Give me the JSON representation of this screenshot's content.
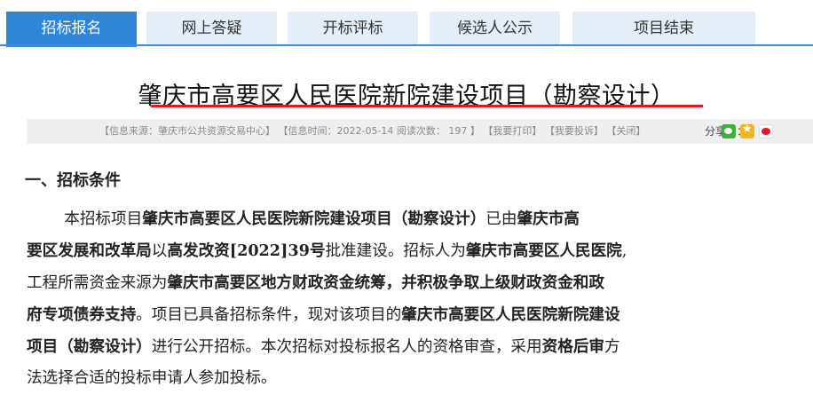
{
  "tabs": [
    {
      "label": "招标报名",
      "active": true
    },
    {
      "label": "网上答疑",
      "active": false
    },
    {
      "label": "开标评标",
      "active": false
    },
    {
      "label": "候选人公示",
      "active": false
    },
    {
      "label": "项目结束",
      "active": false
    }
  ],
  "title": "肇庆市高要区人民医院新院建设项目（勘察设计）",
  "meta": {
    "source": "【信息来源：肇庆市公共资源交易中心】",
    "time": "【信息时间：2022-05-14 阅读次数： 197 】",
    "print": "【我要打印】",
    "complain": "【我要投诉】",
    "close": "【关闭】",
    "share_label": "分享到："
  },
  "section": {
    "heading": "一、招标条件",
    "lines": [
      [
        {
          "t": "本招标项目",
          "b": false
        },
        {
          "t": "肇庆市高要区人民医院新院建设项目（勘察设计）",
          "b": true
        },
        {
          "t": "已由",
          "b": false
        },
        {
          "t": "肇庆市高",
          "b": true
        }
      ],
      [
        {
          "t": "要区发展和改革局",
          "b": true
        },
        {
          "t": "以",
          "b": false
        },
        {
          "t": "高发改资[2022]39号",
          "b": true
        },
        {
          "t": "批准建设。招标人为",
          "b": false
        },
        {
          "t": "肇庆市高要区人民医院",
          "b": true
        },
        {
          "t": ",",
          "b": false
        }
      ],
      [
        {
          "t": "工程所需资金来源为",
          "b": false
        },
        {
          "t": "肇庆市高要区地方财政资金统筹，并积极争取上级财政资金和政",
          "b": true
        }
      ],
      [
        {
          "t": "府专项债券支持",
          "b": true
        },
        {
          "t": "。项目已具备招标条件，现对该项目的",
          "b": false
        },
        {
          "t": "肇庆市高要区人民医院新院建设",
          "b": true
        }
      ],
      [
        {
          "t": "项目（勘察设计）",
          "b": true
        },
        {
          "t": "进行公开招标。本次招标对投标报名人的资格审查，采用",
          "b": false
        },
        {
          "t": "资格后审",
          "b": true
        },
        {
          "t": "方",
          "b": false
        }
      ],
      [
        {
          "t": "法",
          "b": false
        },
        {
          "t": "选择合适的投标申请人参加投标。",
          "b": false
        }
      ]
    ]
  }
}
